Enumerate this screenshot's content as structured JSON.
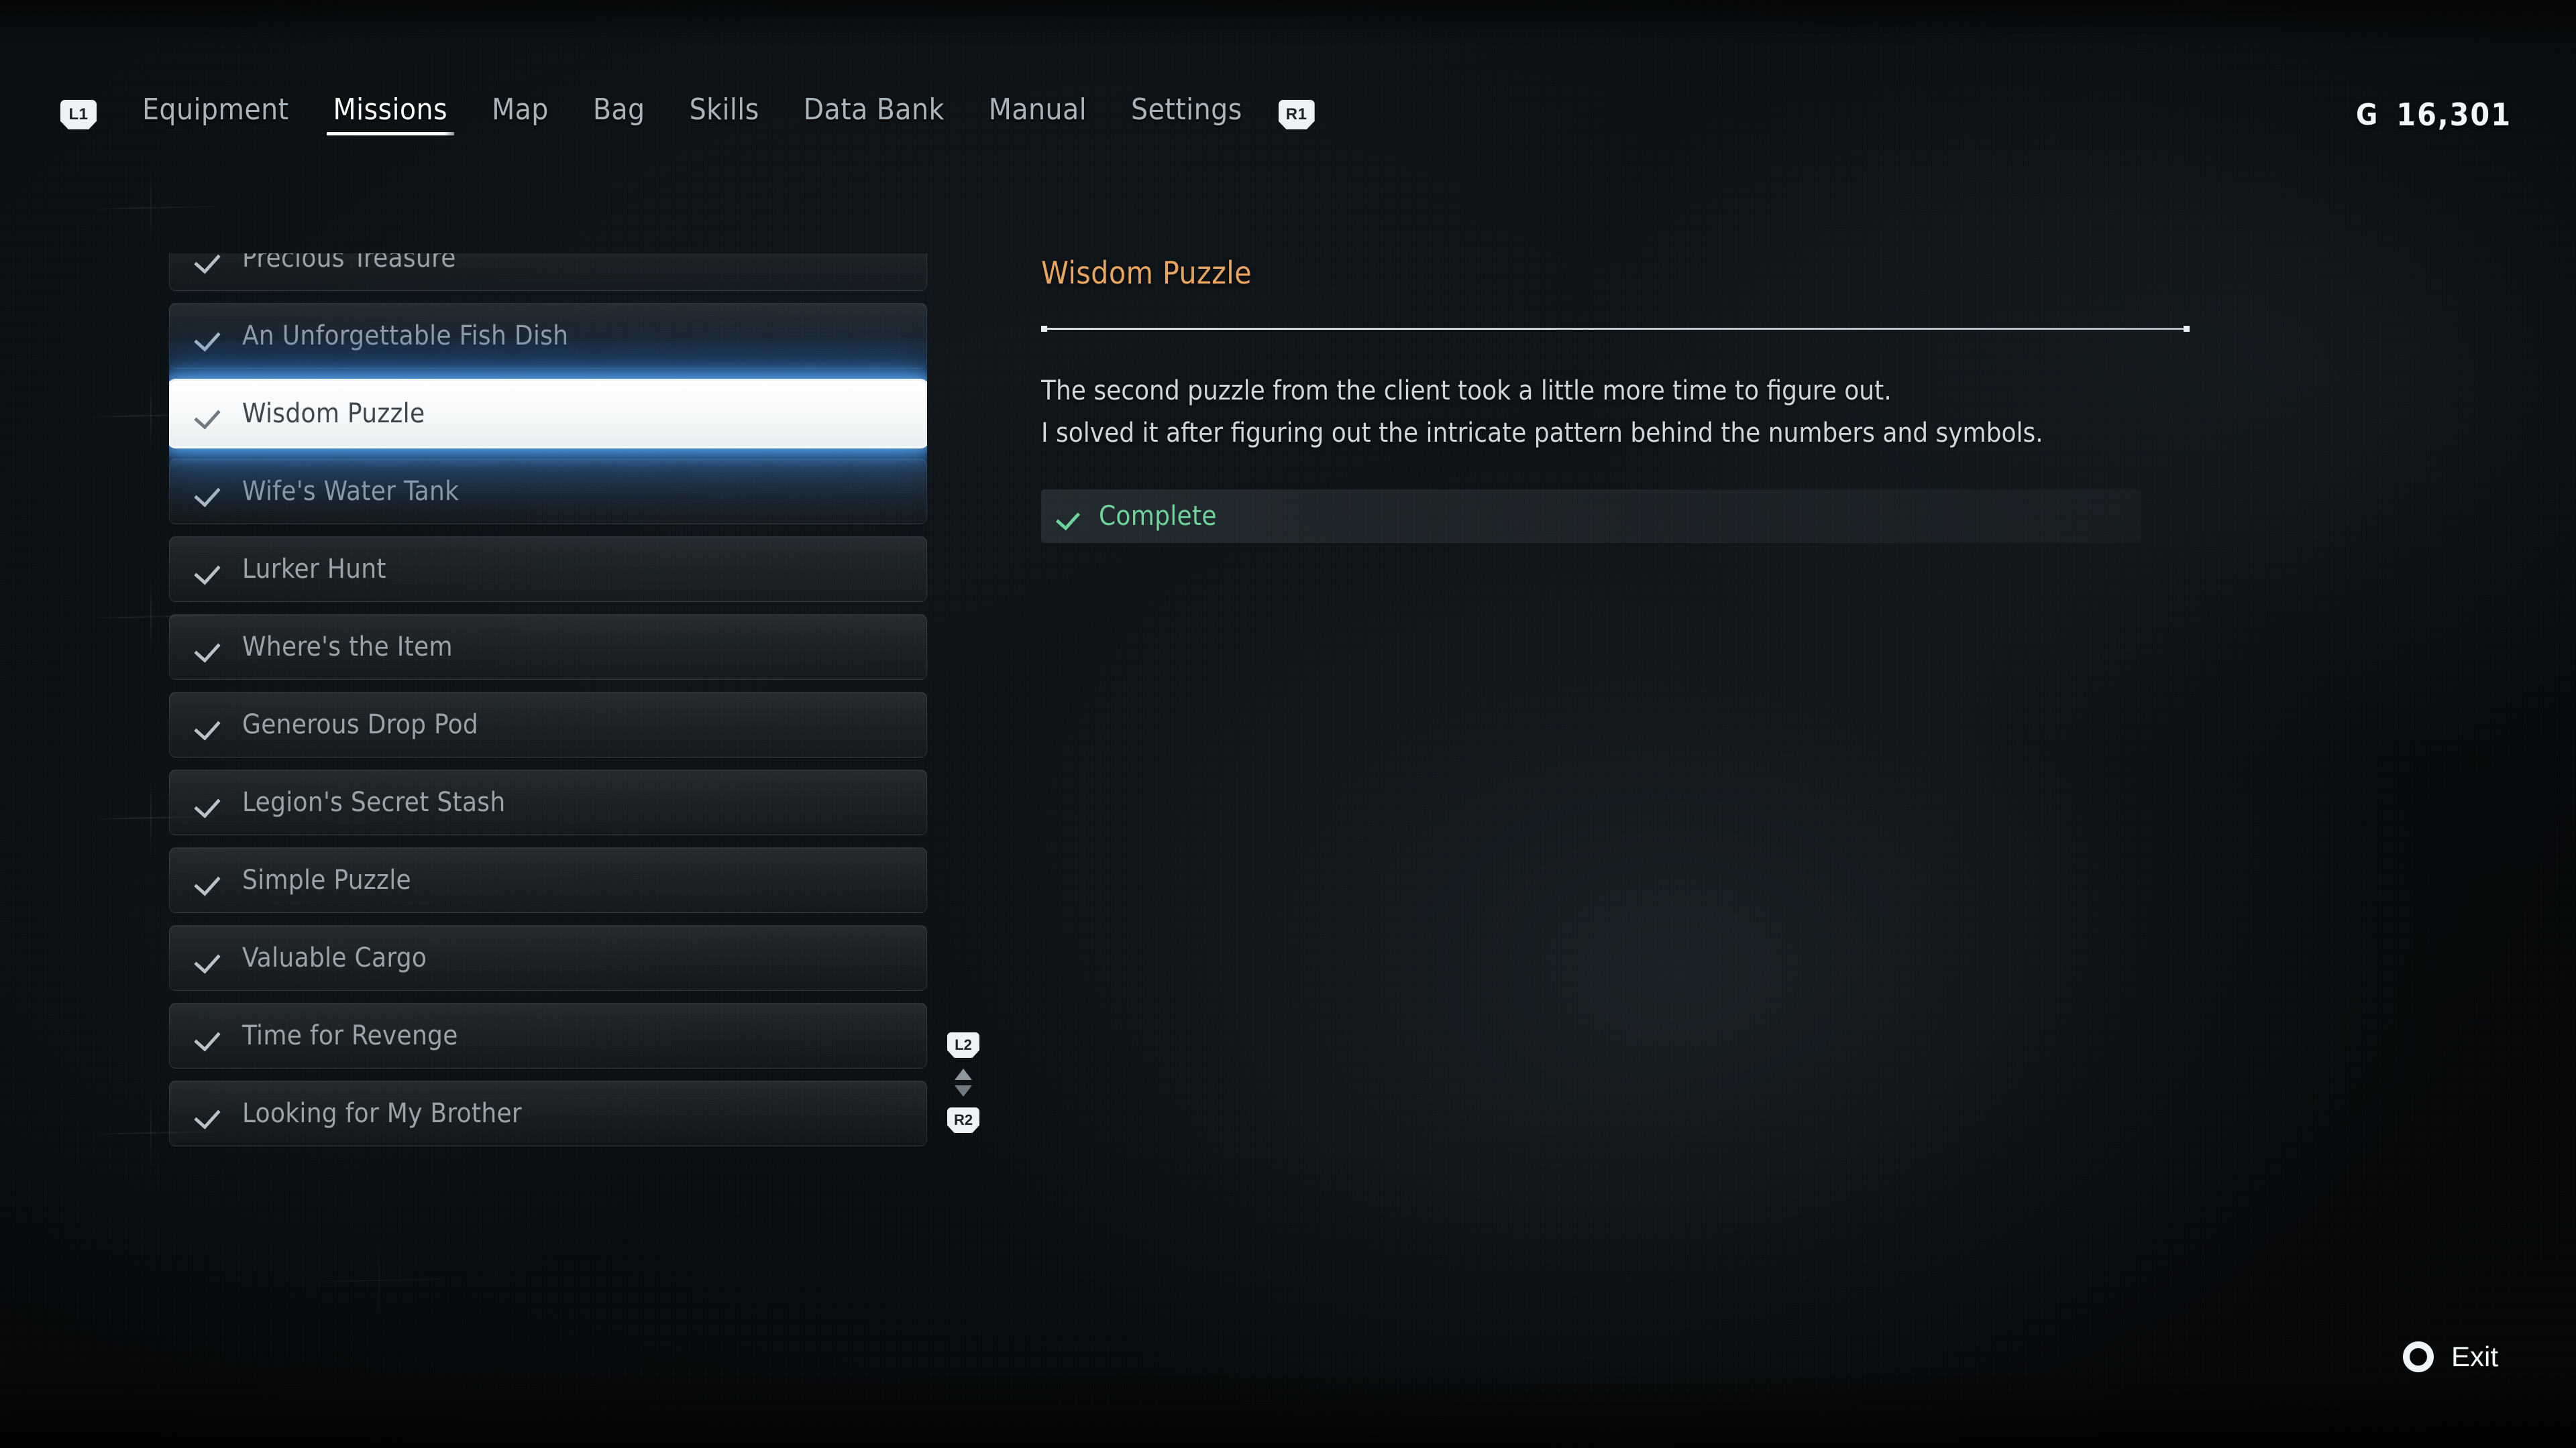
{
  "header": {
    "left_bumper": "L1",
    "right_bumper": "R1",
    "tabs": [
      {
        "label": "Equipment",
        "active": false
      },
      {
        "label": "Missions",
        "active": true
      },
      {
        "label": "Map",
        "active": false
      },
      {
        "label": "Bag",
        "active": false
      },
      {
        "label": "Skills",
        "active": false
      },
      {
        "label": "Data Bank",
        "active": false
      },
      {
        "label": "Manual",
        "active": false
      },
      {
        "label": "Settings",
        "active": false
      }
    ],
    "currency": {
      "symbol": "G",
      "amount": "16,301"
    }
  },
  "mission_list": {
    "items": [
      {
        "label": "Precious Treasure",
        "completed": true,
        "selected": false
      },
      {
        "label": "An Unforgettable Fish Dish",
        "completed": true,
        "selected": false
      },
      {
        "label": "Wisdom Puzzle",
        "completed": true,
        "selected": true
      },
      {
        "label": "Wife's Water Tank",
        "completed": true,
        "selected": false
      },
      {
        "label": "Lurker Hunt",
        "completed": true,
        "selected": false
      },
      {
        "label": "Where's the Item",
        "completed": true,
        "selected": false
      },
      {
        "label": "Generous Drop Pod",
        "completed": true,
        "selected": false
      },
      {
        "label": "Legion's Secret Stash",
        "completed": true,
        "selected": false
      },
      {
        "label": "Simple Puzzle",
        "completed": true,
        "selected": false
      },
      {
        "label": "Valuable Cargo",
        "completed": true,
        "selected": false
      },
      {
        "label": "Time for Revenge",
        "completed": true,
        "selected": false
      },
      {
        "label": "Looking for My Brother",
        "completed": true,
        "selected": false
      }
    ],
    "scroll_hint": {
      "up_trigger": "L2",
      "down_trigger": "R2"
    }
  },
  "detail": {
    "title": "Wisdom Puzzle",
    "description_line_1": "The second puzzle from the client took a little more time to figure out.",
    "description_line_2": "I solved it after figuring out the intricate pattern behind the numbers and symbols.",
    "status_label": "Complete"
  },
  "footer": {
    "exit_label": "Exit",
    "exit_button_glyph": "circle-button-icon"
  },
  "colors": {
    "accent_title": "#e8a55f",
    "status_complete": "#6fd49a",
    "selection_glow": "#60b2ff",
    "selected_bg": "#ffffff",
    "nav_active": "#ffffff",
    "nav_inactive": "#aab4ba",
    "background": "#0d1317"
  }
}
